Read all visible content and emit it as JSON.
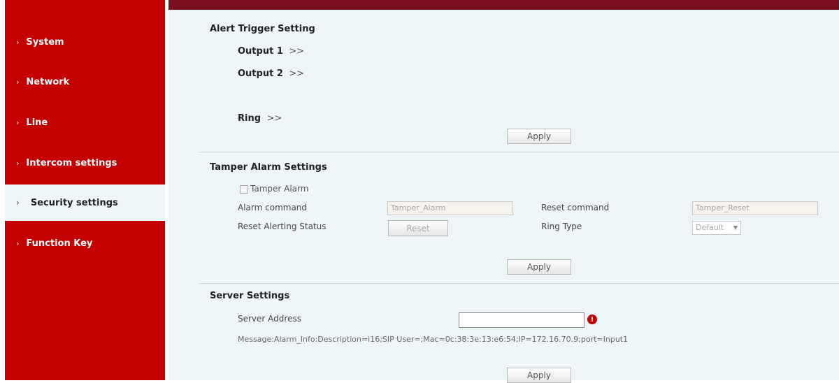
{
  "sidebar": {
    "items": [
      {
        "label": "System"
      },
      {
        "label": "Network"
      },
      {
        "label": "Line"
      },
      {
        "label": "Intercom settings"
      },
      {
        "label": "Security settings",
        "active": true
      },
      {
        "label": "Function Key"
      }
    ],
    "chevron": "›"
  },
  "alert": {
    "title": "Alert Trigger Setting",
    "links": [
      {
        "label": "Output 1",
        "arrows": ">>"
      },
      {
        "label": "Output 2",
        "arrows": ">>"
      },
      {
        "label": "Ring",
        "arrows": ">>"
      }
    ],
    "apply_label": "Apply"
  },
  "tamper": {
    "title": "Tamper Alarm Settings",
    "checkbox_label": "Tamper Alarm",
    "checked": false,
    "alarm_command_label": "Alarm command",
    "alarm_command_value": "Tamper_Alarm",
    "reset_command_label": "Reset command",
    "reset_command_value": "Tamper_Reset",
    "reset_status_label": "Reset Alerting Status",
    "reset_button_label": "Reset",
    "ring_type_label": "Ring Type",
    "ring_type_value": "Default",
    "ring_type_caret": "▼",
    "apply_label": "Apply"
  },
  "server": {
    "title": "Server Settings",
    "address_label": "Server Address",
    "address_value": "",
    "error_glyph": "!",
    "message": "Message:Alarm_Info:Description=i16;SIP User=;Mac=0c:38:3e:13:e6:54;IP=172.16.70.9;port=Input1",
    "apply_label": "Apply"
  }
}
